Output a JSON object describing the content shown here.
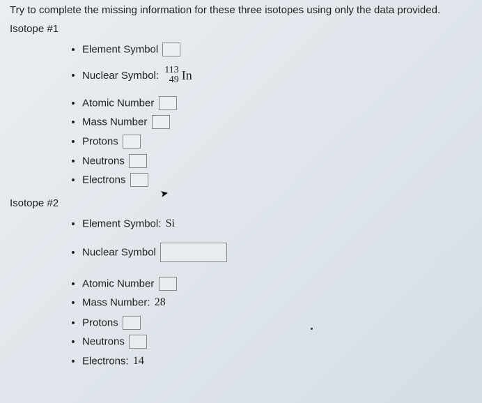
{
  "instruction": "Try to complete the missing information for these three isotopes using only the data provided.",
  "isotope1": {
    "heading": "Isotope #1",
    "elementSymbolLabel": "Element Symbol",
    "nuclearSymbolLabel": "Nuclear Symbol:",
    "nuclearTop": "113",
    "nuclearBottom": "49",
    "nuclearElement": "In",
    "atomicNumberLabel": "Atomic Number",
    "massNumberLabel": "Mass Number",
    "protonsLabel": "Protons",
    "neutronsLabel": "Neutrons",
    "electronsLabel": "Electrons"
  },
  "isotope2": {
    "heading": "Isotope #2",
    "elementSymbolLabel": "Element Symbol:",
    "elementSymbolValue": "Si",
    "nuclearSymbolLabel": "Nuclear Symbol",
    "atomicNumberLabel": "Atomic Number",
    "massNumberLabel": "Mass Number:",
    "massNumberValue": "28",
    "protonsLabel": "Protons",
    "neutronsLabel": "Neutrons",
    "electronsLabel": "Electrons:",
    "electronsValue": "14"
  }
}
